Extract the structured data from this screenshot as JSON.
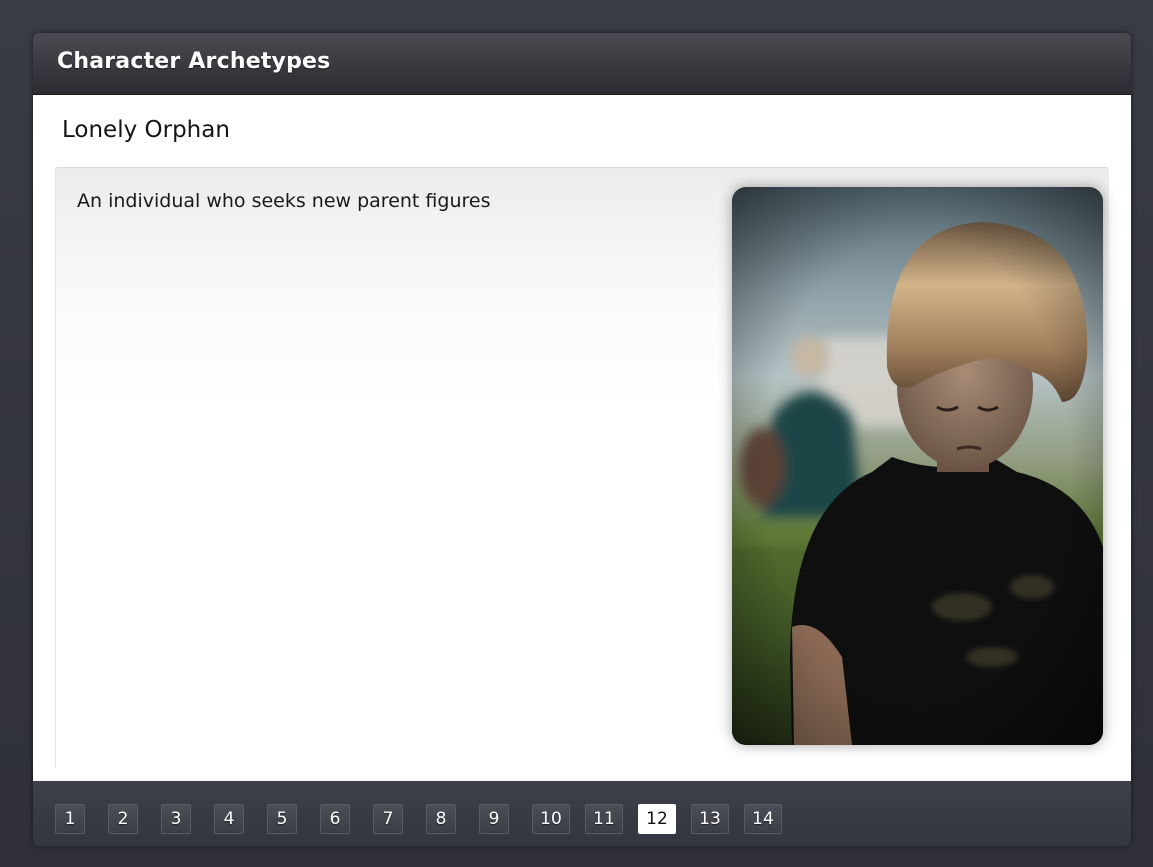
{
  "window": {
    "title": "Character Archetypes"
  },
  "slide": {
    "heading": "Lonely Orphan",
    "description": "An individual who seeks new parent figures",
    "image": {
      "subject": "sad-child-photo",
      "accent_colors": [
        "#1a1a1a",
        "#6f8b3a",
        "#c9a46a"
      ]
    }
  },
  "pagination": {
    "pages": [
      "1",
      "2",
      "3",
      "4",
      "5",
      "6",
      "7",
      "8",
      "9",
      "10",
      "11",
      "12",
      "13",
      "14"
    ],
    "current": "12"
  },
  "colors": {
    "title_bar": "#2b2c31",
    "frame": "#3b3d47",
    "active_page": "#ffffff"
  }
}
